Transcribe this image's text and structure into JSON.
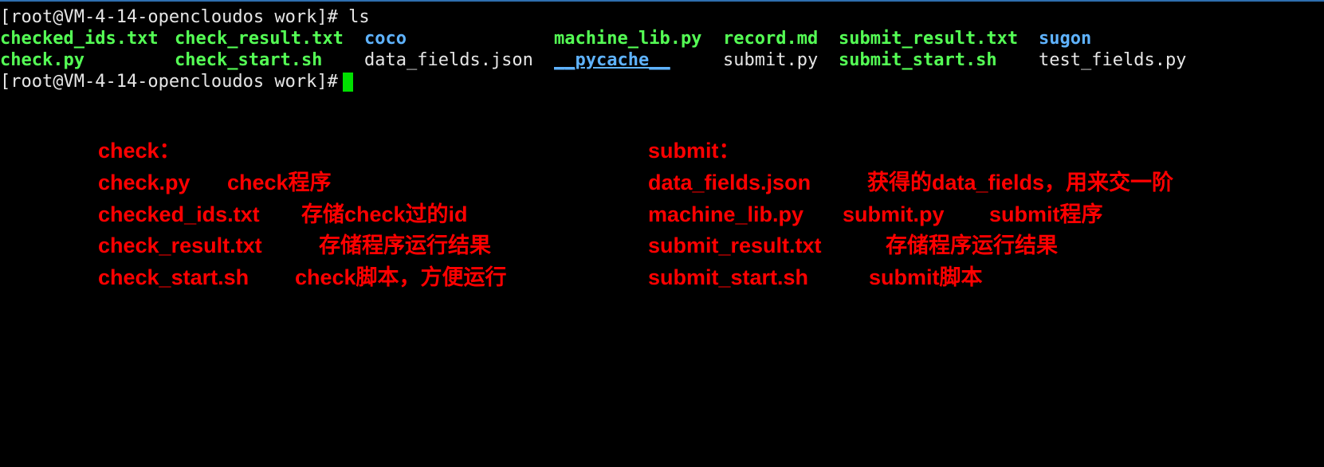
{
  "terminal": {
    "prompt_line_1": "[root@VM-4-14-opencloudos work]# ls",
    "listing": {
      "row1": {
        "c1": "checked_ids.txt",
        "c2": "check_result.txt",
        "c3": "coco",
        "c4": "machine_lib.py",
        "c5": "record.md",
        "c6": "submit_result.txt",
        "c7": "sugon"
      },
      "row2": {
        "c1": "check.py",
        "c2": "check_start.sh",
        "c3": "data_fields.json",
        "c4": "__pycache__",
        "c5": "submit.py",
        "c6": "submit_start.sh",
        "c7": "test_fields.py"
      }
    },
    "prompt_line_2": "[root@VM-4-14-opencloudos work]# ",
    "colors": {
      "background": "#000000",
      "text": "#e6e6e6",
      "executable": "#55ff55",
      "directory": "#5fb3ff",
      "cursor": "#00e000",
      "annotation": "#ff0000"
    }
  },
  "annotations": {
    "check": {
      "heading": "check：",
      "items": [
        {
          "file": "check.py",
          "desc": "check程序"
        },
        {
          "file": "checked_ids.txt",
          "desc": "存储check过的id"
        },
        {
          "file": "check_result.txt",
          "desc": "存储程序运行结果"
        },
        {
          "file": "check_start.sh",
          "desc": "check脚本，方便运行"
        }
      ]
    },
    "submit": {
      "heading": "submit：",
      "items": [
        {
          "file": "data_fields.json",
          "desc": "获得的data_fields，用来交一阶"
        },
        {
          "file": "machine_lib.py",
          "desc": "submit.py",
          "desc2": "submit程序"
        },
        {
          "file": "submit_result.txt",
          "desc": "存储程序运行结果"
        },
        {
          "file": "submit_start.sh",
          "desc": "submit脚本"
        }
      ]
    }
  }
}
